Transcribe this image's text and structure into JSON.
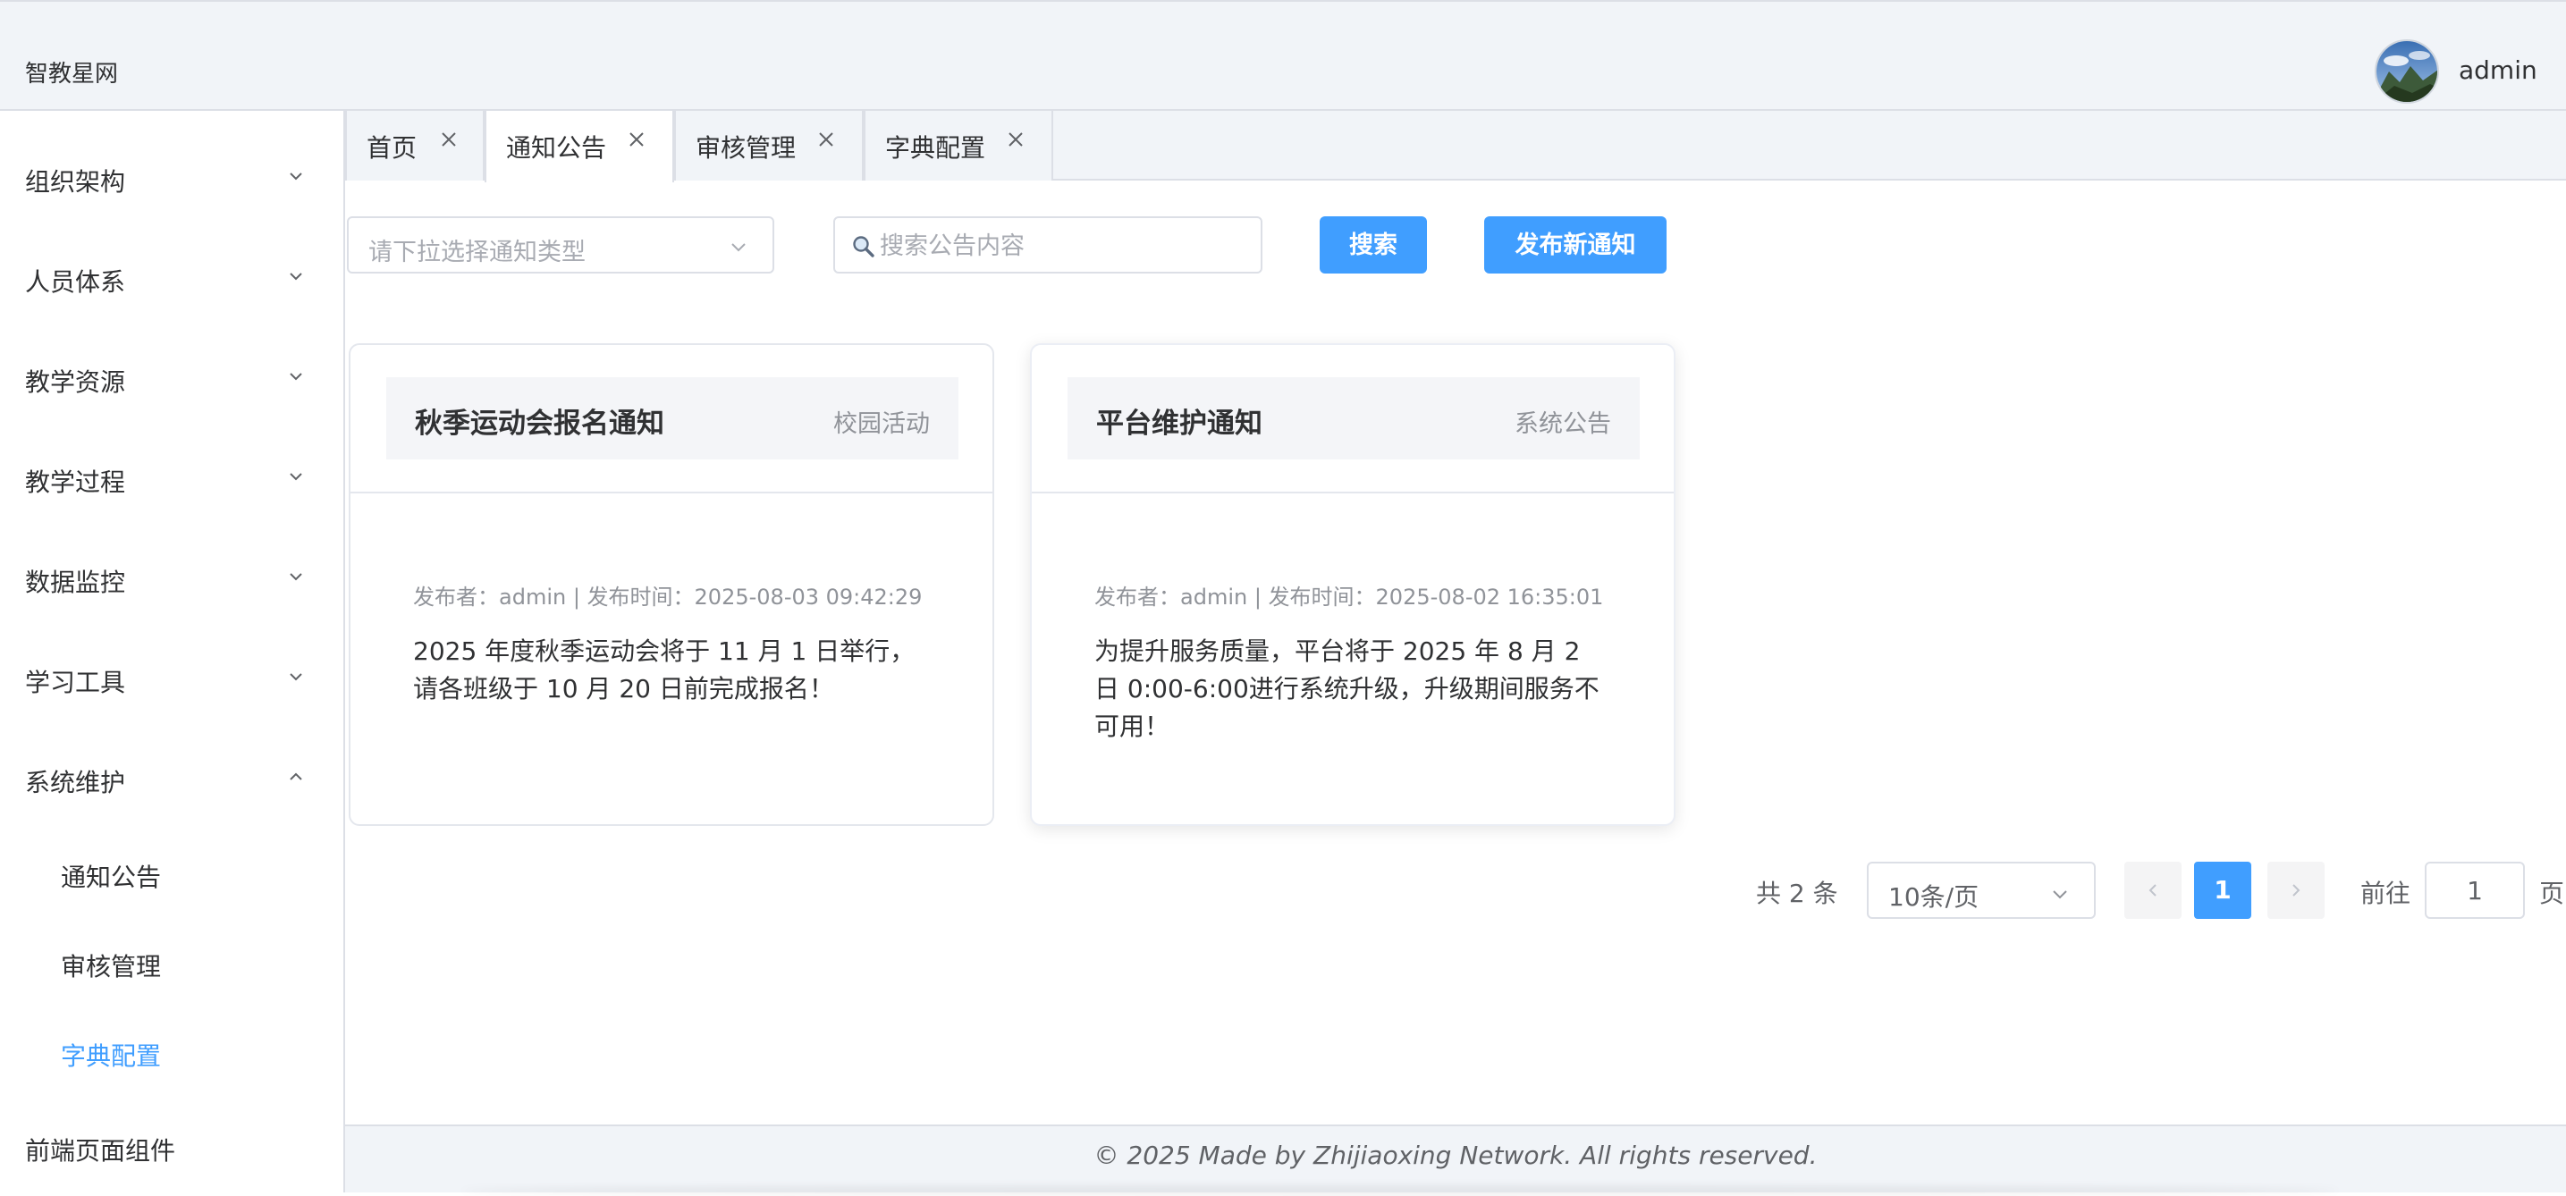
{
  "header": {
    "brand": "智教星网",
    "username": "admin"
  },
  "sidebar": {
    "groups": [
      {
        "label": "组织架构",
        "expanded": false
      },
      {
        "label": "人员体系",
        "expanded": false
      },
      {
        "label": "教学资源",
        "expanded": false
      },
      {
        "label": "教学过程",
        "expanded": false
      },
      {
        "label": "数据监控",
        "expanded": false
      },
      {
        "label": "学习工具",
        "expanded": false
      },
      {
        "label": "系统维护",
        "expanded": true
      },
      {
        "label": "前端页面组件",
        "expanded": false
      }
    ],
    "sub_items": [
      {
        "label": "通知公告",
        "active": false
      },
      {
        "label": "审核管理",
        "active": false
      },
      {
        "label": "字典配置",
        "active": true
      }
    ]
  },
  "tabs": [
    {
      "label": "首页",
      "active": false
    },
    {
      "label": "通知公告",
      "active": true
    },
    {
      "label": "审核管理",
      "active": false
    },
    {
      "label": "字典配置",
      "active": false
    }
  ],
  "toolbar": {
    "type_select_placeholder": "请下拉选择通知类型",
    "search_placeholder": "搜索公告内容",
    "search_label": "搜索",
    "publish_label": "发布新通知"
  },
  "notices": [
    {
      "title": "秋季运动会报名通知",
      "category": "校园活动",
      "meta": "发布者：admin | 发布时间：2025-08-03 09:42:29",
      "content": "2025 年度秋季运动会将于 11 月 1 日举行，请各班级于 10 月 20 日前完成报名！"
    },
    {
      "title": "平台维护通知",
      "category": "系统公告",
      "meta": "发布者：admin | 发布时间：2025-08-02 16:35:01",
      "content": "为提升服务质量，平台将于 2025 年 8 月 2 日 0:00-6:00进行系统升级，升级期间服务不可用！"
    }
  ],
  "pagination": {
    "total_text": "共 2 条",
    "page_size": "10条/页",
    "current_page": "1",
    "goto_label": "前往",
    "goto_value": "1",
    "suffix": "页"
  },
  "footer": {
    "text": "© 2025 Made by Zhijiaoxing Network. All rights reserved."
  },
  "colors": {
    "primary": "#409eff",
    "header_bg": "#f1f4f8",
    "border": "#dcdfe6",
    "muted_text": "#909399"
  }
}
